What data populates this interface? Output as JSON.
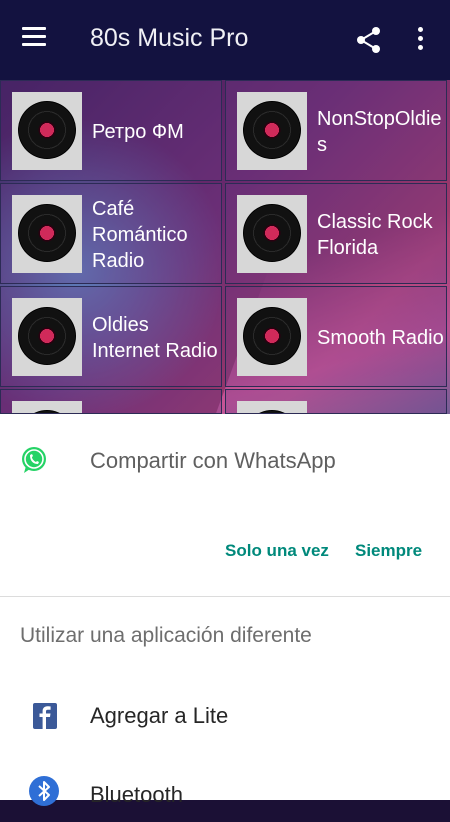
{
  "app": {
    "title": "80s Music Pro",
    "menu_icon": "hamburger-menu-icon",
    "share_icon": "share-icon",
    "more_icon": "more-vert-icon",
    "appbar_color": "#131240"
  },
  "stations": [
    {
      "label": "Ретро ФМ",
      "icon": "vinyl-record-icon"
    },
    {
      "label": "NonStopOldies",
      "icon": "vinyl-record-icon"
    },
    {
      "label": "Café Romántico Radio",
      "icon": "vinyl-record-icon"
    },
    {
      "label": "Classic Rock Florida",
      "icon": "vinyl-record-icon"
    },
    {
      "label": "Oldies Internet Radio",
      "icon": "vinyl-record-icon"
    },
    {
      "label": "Smooth Radio",
      "icon": "vinyl-record-icon"
    },
    {
      "label": "",
      "icon": "vinyl-record-icon"
    },
    {
      "label": "",
      "icon": "vinyl-record-icon"
    }
  ],
  "share_sheet": {
    "primary_app": {
      "label": "Compartir con WhatsApp",
      "icon": "whatsapp-icon",
      "color": "#25D366"
    },
    "just_once_label": "Solo una vez",
    "always_label": "Siempre",
    "accent_color": "#00897b",
    "other_label": "Utilizar una aplicación diferente",
    "apps": [
      {
        "label": "Agregar a Lite",
        "icon": "facebook-icon",
        "color": "#3b5998"
      },
      {
        "label": "Bluetooth",
        "icon": "bluetooth-icon",
        "color": "#2f6fd6"
      }
    ]
  }
}
